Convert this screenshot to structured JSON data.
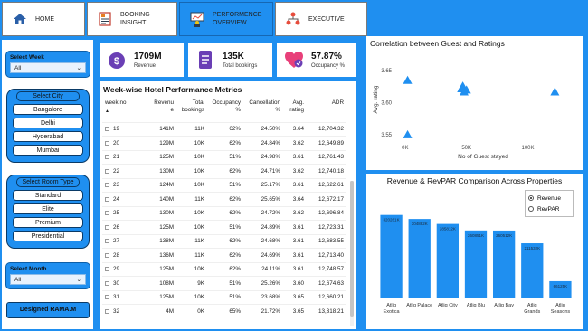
{
  "nav": {
    "home": "HOME",
    "booking_line1": "BOOKING",
    "booking_line2": "INSIGHT",
    "perf_line1": "PERFORMENCE",
    "perf_line2": "OVERVIEW",
    "executive": "EXECUTIVE"
  },
  "filters": {
    "select_week_title": "Select Week",
    "select_week_value": "All",
    "select_city_title": "Select City",
    "cities": [
      "Bangalore",
      "Delhi",
      "Hyderabad",
      "Mumbai"
    ],
    "select_room_title": "Select Room Type",
    "rooms": [
      "Standard",
      "Elite",
      "Premium",
      "Presidential"
    ],
    "select_month_title": "Select Month",
    "select_month_value": "All",
    "designed_by": "Designed RAMA.M"
  },
  "kpis": {
    "revenue_value": "1709M",
    "revenue_label": "Revenue",
    "bookings_value": "135K",
    "bookings_label": "Total bookings",
    "occupancy_value": "57.87%",
    "occupancy_label": "Occupancy %"
  },
  "table": {
    "title": "Week-wise Hotel Performance Metrics",
    "headers": {
      "week": "week no",
      "revenue1": "Revenu",
      "revenue2": "e",
      "bookings1": "Total",
      "bookings2": "bookings",
      "occ1": "Occupancy",
      "occ2": "%",
      "canc1": "Cancellation",
      "canc2": "%",
      "rating1": "Avg.",
      "rating2": "rating",
      "adr": "ADR"
    },
    "rows": [
      {
        "week": "19",
        "revenue": "141M",
        "bookings": "11K",
        "occupancy": "62%",
        "cancellation": "24.50%",
        "rating": "3.64",
        "adr": "12,704.32"
      },
      {
        "week": "20",
        "revenue": "129M",
        "bookings": "10K",
        "occupancy": "62%",
        "cancellation": "24.84%",
        "rating": "3.62",
        "adr": "12,649.89"
      },
      {
        "week": "21",
        "revenue": "125M",
        "bookings": "10K",
        "occupancy": "51%",
        "cancellation": "24.98%",
        "rating": "3.61",
        "adr": "12,761.43"
      },
      {
        "week": "22",
        "revenue": "130M",
        "bookings": "10K",
        "occupancy": "62%",
        "cancellation": "24.71%",
        "rating": "3.62",
        "adr": "12,740.18"
      },
      {
        "week": "23",
        "revenue": "124M",
        "bookings": "10K",
        "occupancy": "51%",
        "cancellation": "25.17%",
        "rating": "3.61",
        "adr": "12,622.61"
      },
      {
        "week": "24",
        "revenue": "140M",
        "bookings": "11K",
        "occupancy": "62%",
        "cancellation": "25.65%",
        "rating": "3.64",
        "adr": "12,672.17"
      },
      {
        "week": "25",
        "revenue": "130M",
        "bookings": "10K",
        "occupancy": "62%",
        "cancellation": "24.72%",
        "rating": "3.62",
        "adr": "12,696.84"
      },
      {
        "week": "26",
        "revenue": "125M",
        "bookings": "10K",
        "occupancy": "51%",
        "cancellation": "24.89%",
        "rating": "3.61",
        "adr": "12,723.31"
      },
      {
        "week": "27",
        "revenue": "138M",
        "bookings": "11K",
        "occupancy": "62%",
        "cancellation": "24.68%",
        "rating": "3.61",
        "adr": "12,683.55"
      },
      {
        "week": "28",
        "revenue": "136M",
        "bookings": "11K",
        "occupancy": "62%",
        "cancellation": "24.69%",
        "rating": "3.61",
        "adr": "12,713.40"
      },
      {
        "week": "29",
        "revenue": "125M",
        "bookings": "10K",
        "occupancy": "62%",
        "cancellation": "24.11%",
        "rating": "3.61",
        "adr": "12,748.57"
      },
      {
        "week": "30",
        "revenue": "108M",
        "bookings": "9K",
        "occupancy": "51%",
        "cancellation": "25.26%",
        "rating": "3.60",
        "adr": "12,674.63"
      },
      {
        "week": "31",
        "revenue": "125M",
        "bookings": "10K",
        "occupancy": "51%",
        "cancellation": "23.68%",
        "rating": "3.65",
        "adr": "12,660.21"
      },
      {
        "week": "32",
        "revenue": "4M",
        "bookings": "0K",
        "occupancy": "65%",
        "cancellation": "21.72%",
        "rating": "3.65",
        "adr": "13,318.21"
      }
    ]
  },
  "scatter": {
    "title": "Correlation between Guest and Ratings",
    "chart_data": {
      "type": "scatter",
      "xlabel": "No of Guest stayed",
      "ylabel": "Avg. rating",
      "x_ticks": [
        0,
        50000,
        100000
      ],
      "x_tick_labels": [
        "0K",
        "50K",
        "100K"
      ],
      "y_ticks": [
        3.55,
        3.6,
        3.65
      ],
      "y_tick_labels": [
        "3.55",
        "3.60",
        "3.65"
      ],
      "xlim": [
        -8000,
        135000
      ],
      "ylim": [
        3.54,
        3.67
      ],
      "x": [
        2000,
        2000,
        46000,
        47000,
        48000,
        50000,
        122000
      ],
      "y": [
        3.55,
        3.635,
        3.622,
        3.626,
        3.617,
        3.62,
        3.617
      ],
      "color": "#1f8ff0"
    }
  },
  "bars": {
    "title": "Revenue & RevPAR Comparison Across Properties",
    "legend": [
      "Revenue",
      "RevPAR"
    ],
    "chart_data": {
      "type": "bar",
      "categories": [
        "Atliq Exotica",
        "Atliq Palace",
        "Atliq City",
        "Atliq Blu",
        "Atliq Bay",
        "Atliq Grands",
        "Atliq Seasons"
      ],
      "category_lines": [
        [
          "Atliq",
          "Exotica"
        ],
        [
          "Atliq Palace"
        ],
        [
          "Atliq City"
        ],
        [
          "Atliq Blu"
        ],
        [
          "Atliq Bay"
        ],
        [
          "Atliq",
          "Grands"
        ],
        [
          "Atliq",
          "Seasons"
        ]
      ],
      "values": [
        320.26,
        304.88,
        285.81,
        260.85,
        260.51,
        211.53,
        66.13
      ],
      "value_labels": [
        "320261K",
        "304882K",
        "285812K",
        "260851K",
        "260512K",
        "211532K",
        "66125K"
      ],
      "series": [
        {
          "name": "Revenue"
        }
      ],
      "ylim": [
        0,
        340
      ],
      "color": "#1f8ff0"
    }
  }
}
